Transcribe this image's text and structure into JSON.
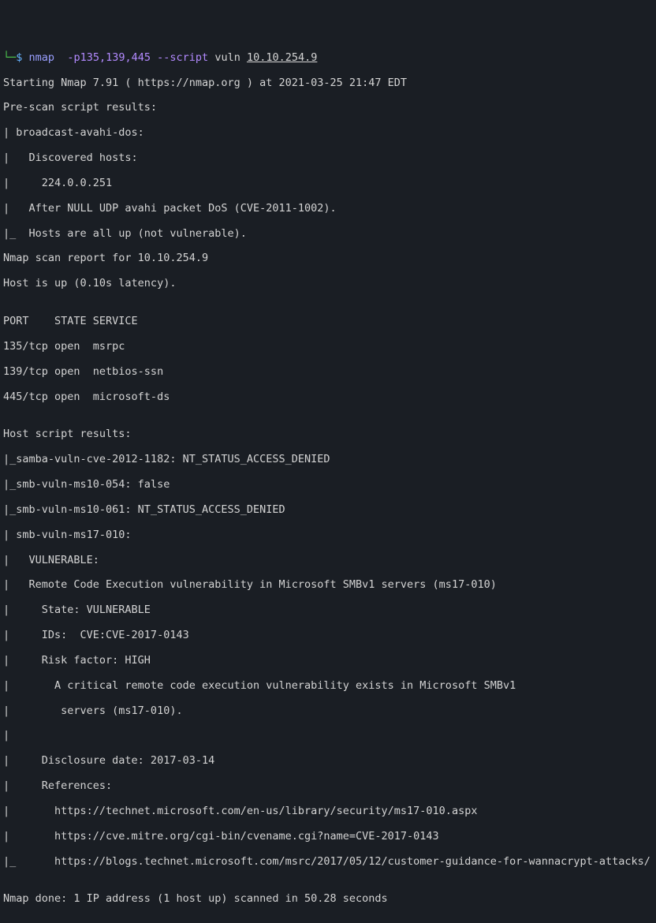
{
  "prompt": {
    "arrow": "└─",
    "dollar": "$",
    "cmd": "nmap",
    "flag1": "-p135,139,445",
    "flag2": "--script",
    "scriptarg": "vuln",
    "target": "10.10.254.9"
  },
  "output": {
    "l01": "Starting Nmap 7.91 ( https://nmap.org ) at 2021-03-25 21:47 EDT",
    "l02": "Pre-scan script results:",
    "l03": "| broadcast-avahi-dos:",
    "l04": "|   Discovered hosts:",
    "l05": "|     224.0.0.251",
    "l06": "|   After NULL UDP avahi packet DoS (CVE-2011-1002).",
    "l07": "|_  Hosts are all up (not vulnerable).",
    "l08": "Nmap scan report for 10.10.254.9",
    "l09": "Host is up (0.10s latency).",
    "l10": "",
    "l11": "PORT    STATE SERVICE",
    "l12": "135/tcp open  msrpc",
    "l13": "139/tcp open  netbios-ssn",
    "l14": "445/tcp open  microsoft-ds",
    "l15": "",
    "l16": "Host script results:",
    "l17": "|_samba-vuln-cve-2012-1182: NT_STATUS_ACCESS_DENIED",
    "l18": "|_smb-vuln-ms10-054: false",
    "l19": "|_smb-vuln-ms10-061: NT_STATUS_ACCESS_DENIED",
    "l20": "| smb-vuln-ms17-010:",
    "l21": "|   VULNERABLE:",
    "l22": "|   Remote Code Execution vulnerability in Microsoft SMBv1 servers (ms17-010)",
    "l23": "|     State: VULNERABLE",
    "l24": "|     IDs:  CVE:CVE-2017-0143",
    "l25": "|     Risk factor: HIGH",
    "l26": "|       A critical remote code execution vulnerability exists in Microsoft SMBv1",
    "l27": "|        servers (ms17-010).",
    "l28": "|",
    "l29": "|     Disclosure date: 2017-03-14",
    "l30": "|     References:",
    "l31": "|       https://technet.microsoft.com/en-us/library/security/ms17-010.aspx",
    "l32": "|       https://cve.mitre.org/cgi-bin/cvename.cgi?name=CVE-2017-0143",
    "l33": "|_      https://blogs.technet.microsoft.com/msrc/2017/05/12/customer-guidance-for-wannacrypt-attacks/",
    "l34": "",
    "l35": "Nmap done: 1 IP address (1 host up) scanned in 50.28 seconds"
  }
}
